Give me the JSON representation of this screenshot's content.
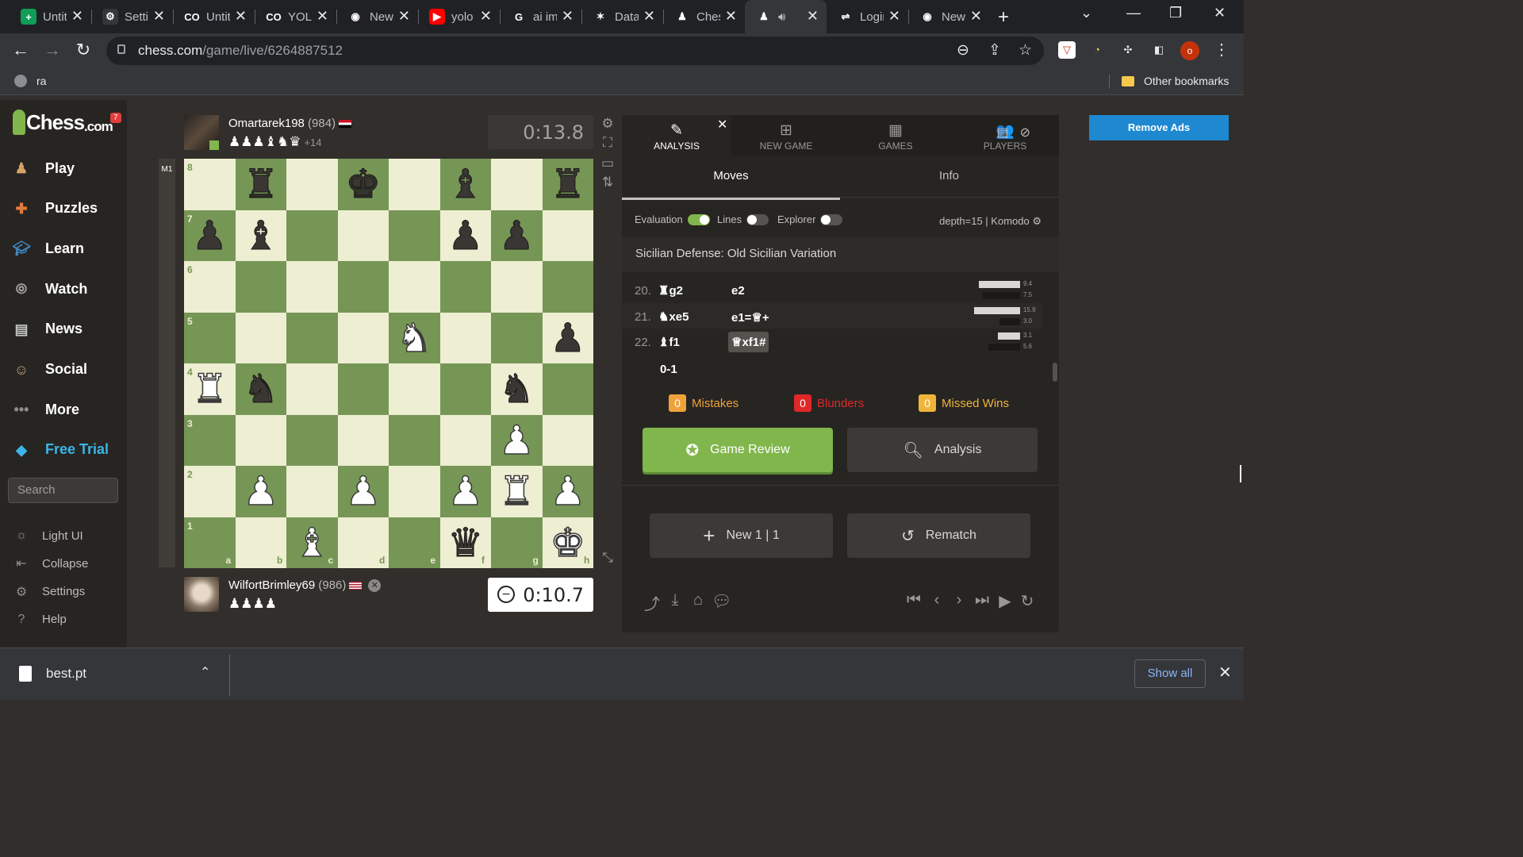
{
  "browser": {
    "tabs": [
      {
        "title": "Untitled",
        "icon": "sheets-icon",
        "icon_glyph": "+",
        "icon_color": "#0f9d58"
      },
      {
        "title": "Settings",
        "icon": "gear-icon",
        "icon_glyph": "⚙",
        "icon_color": "#35363a"
      },
      {
        "title": "Untitled",
        "icon": "colab-icon",
        "icon_glyph": "CO",
        "icon_color": "#202124"
      },
      {
        "title": "YOLO",
        "icon": "colab-icon",
        "icon_glyph": "CO",
        "icon_color": "#202124"
      },
      {
        "title": "New Tab",
        "icon": "chrome-icon",
        "icon_glyph": "◉",
        "icon_color": "#202124"
      },
      {
        "title": "yolo",
        "icon": "youtube-icon",
        "icon_glyph": "▶",
        "icon_color": "#ff0000"
      },
      {
        "title": "ai image",
        "icon": "google-icon",
        "icon_glyph": "G",
        "icon_color": "#202124"
      },
      {
        "title": "Data",
        "icon": "dataset-icon",
        "icon_glyph": "✶",
        "icon_color": "#202124"
      },
      {
        "title": "Chess",
        "icon": "chess-pawn-icon",
        "icon_glyph": "♟",
        "icon_color": "#202124"
      },
      {
        "title": "",
        "icon": "chess-pawn-icon",
        "icon_glyph": "♟",
        "icon_color": "#35363a",
        "active": true
      },
      {
        "title": "Login",
        "icon": "login-icon",
        "icon_glyph": "⇌",
        "icon_color": "#202124"
      },
      {
        "title": "New Tab",
        "icon": "chrome-icon",
        "icon_glyph": "◉",
        "icon_color": "#202124"
      }
    ],
    "url_host": "chess.com",
    "url_path": "/game/live/6264887512",
    "bookmarks": {
      "left": "ra",
      "right": "Other bookmarks"
    },
    "profile_initial": "o",
    "downloads": {
      "file": "best.pt",
      "show_all": "Show all"
    }
  },
  "sidebar": {
    "logo_text": "Chess",
    "logo_suffix": ".com",
    "notification_count": "7",
    "nav": [
      {
        "label": "Play",
        "icon": "play-icon",
        "color": "#d6a565"
      },
      {
        "label": "Puzzles",
        "icon": "puzzle-icon",
        "color": "#e07a3c"
      },
      {
        "label": "Learn",
        "icon": "learn-icon",
        "color": "#3f88c5"
      },
      {
        "label": "Watch",
        "icon": "binoculars-icon",
        "color": "#a0a0a0"
      },
      {
        "label": "News",
        "icon": "news-icon",
        "color": "#c6c6c6"
      },
      {
        "label": "Social",
        "icon": "social-icon",
        "color": "#b9a07a"
      },
      {
        "label": "More",
        "icon": "more-icon",
        "color": "#8f8d8b"
      },
      {
        "label": "Free Trial",
        "icon": "diamond-icon",
        "color": "#3bb6e8"
      }
    ],
    "search_placeholder": "Search",
    "sub": [
      {
        "label": "Light UI",
        "icon": "sun-icon"
      },
      {
        "label": "Collapse",
        "icon": "collapse-icon"
      },
      {
        "label": "Settings",
        "icon": "gear-icon"
      },
      {
        "label": "Help",
        "icon": "help-icon"
      }
    ]
  },
  "game": {
    "top_player": {
      "name": "Omartarek198",
      "rating": "(984)",
      "captured": "♟♟♟♝♞♛",
      "advantage": "+14",
      "clock": "0:13.8"
    },
    "bottom_player": {
      "name": "WilfortBrimley69",
      "rating": "(986)",
      "captured": "♟♟♟♟",
      "clock": "0:10.7"
    },
    "eval_label": "M1",
    "files": [
      "a",
      "b",
      "c",
      "d",
      "e",
      "f",
      "g",
      "h"
    ],
    "ranks": [
      "8",
      "7",
      "6",
      "5",
      "4",
      "3",
      "2",
      "1"
    ],
    "position": [
      [
        "",
        "r",
        "",
        "k",
        "",
        "b",
        "",
        "r"
      ],
      [
        "p",
        "b",
        "",
        "",
        "",
        "p",
        "p",
        ""
      ],
      [
        "",
        "",
        "",
        "",
        "",
        "",
        "",
        ""
      ],
      [
        "",
        "",
        "",
        "",
        "N",
        "",
        "",
        "p"
      ],
      [
        "R",
        "n",
        "",
        "",
        "",
        "",
        "n",
        ""
      ],
      [
        "",
        "",
        "",
        "",
        "",
        "",
        "P",
        ""
      ],
      [
        "",
        "P",
        "",
        "P",
        "",
        "P",
        "R",
        "P"
      ],
      [
        "",
        "",
        "B",
        "",
        "",
        "q",
        "",
        "K"
      ]
    ]
  },
  "panel": {
    "tabs": [
      {
        "label": "ANALYSIS",
        "icon": "analysis-icon",
        "glyph": "✎"
      },
      {
        "label": "NEW GAME",
        "icon": "plus-square-icon",
        "glyph": "⊞"
      },
      {
        "label": "GAMES",
        "icon": "board-icon",
        "glyph": "▦"
      },
      {
        "label": "PLAYERS",
        "icon": "players-icon",
        "glyph": "👥"
      }
    ],
    "subtabs": [
      "Moves",
      "Info"
    ],
    "toggles": {
      "evaluation": "Evaluation",
      "lines": "Lines",
      "explorer": "Explorer",
      "engine": "depth=15 |  Komodo"
    },
    "opening": "Sicilian Defense: Old Sicilian Variation",
    "moves": [
      {
        "num": "20.",
        "white": "♜g2",
        "black": "e2",
        "t_white": "9.4",
        "t_black": "7.5",
        "w_frac": 0.52,
        "b_frac": 0.47
      },
      {
        "num": "21.",
        "white": "♞xe5",
        "black": "e1=♕+",
        "t_white": "15.9",
        "t_black": "3.0",
        "w_frac": 0.58,
        "b_frac": 0.26
      },
      {
        "num": "22.",
        "white": "♝f1",
        "black": "♕xf1#",
        "t_white": "3.1",
        "t_black": "5.6",
        "w_frac": 0.28,
        "b_frac": 0.4
      }
    ],
    "result": "0-1",
    "stats": {
      "mistakes": {
        "count": "0",
        "label": "Mistakes",
        "color": "#f0a23a"
      },
      "blunders": {
        "count": "0",
        "label": "Blunders",
        "color": "#e02828"
      },
      "missed": {
        "count": "0",
        "label": "Missed Wins",
        "color": "#f0b43a"
      }
    },
    "buttons": {
      "review": "Game Review",
      "analysis": "Analysis",
      "new_game": "New 1 | 1",
      "rematch": "Rematch"
    },
    "remove_ads": "Remove Ads"
  },
  "colors": {
    "board_light": "#eeeed2",
    "board_dark": "#769656",
    "accent_green": "#81b64c"
  }
}
